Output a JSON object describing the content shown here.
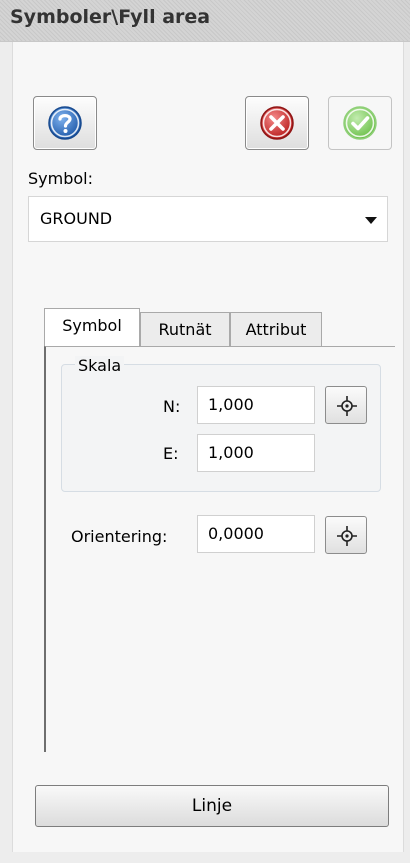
{
  "window": {
    "title": "Symboler\\Fyll area"
  },
  "toolbar": {
    "help_icon": "question-mark-icon",
    "cancel_icon": "red-x-icon",
    "ok_icon": "green-check-icon"
  },
  "symbol": {
    "label": "Symbol:",
    "selected": "GROUND"
  },
  "tabs": [
    {
      "label": "Symbol",
      "active": true
    },
    {
      "label": "Rutnät",
      "active": false
    },
    {
      "label": "Attribut",
      "active": false
    }
  ],
  "scale": {
    "group_title": "Skala",
    "n_label": "N:",
    "n_value": "1,000",
    "e_label": "E:",
    "e_value": "1,000"
  },
  "orientation": {
    "label": "Orientering:",
    "value": "0,0000"
  },
  "footer": {
    "linje_label": "Linje"
  },
  "colors": {
    "help": "#2f6fc1",
    "cancel": "#d93232",
    "ok": "#6cc04a"
  }
}
